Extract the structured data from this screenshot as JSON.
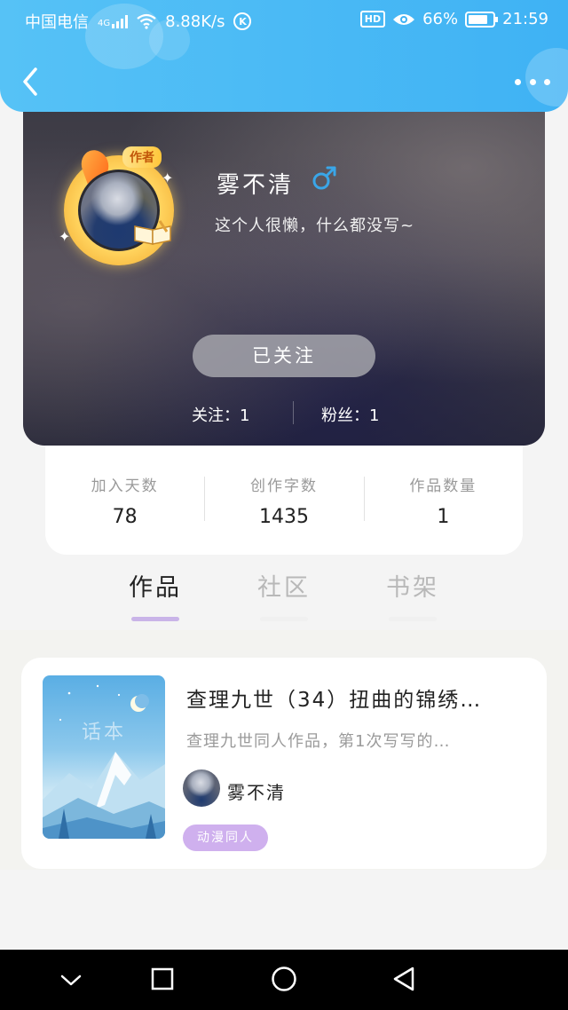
{
  "status_bar": {
    "carrier": "中国电信",
    "network": "4G",
    "speed": "8.88K/s",
    "k_badge": "K",
    "hd": "HD",
    "battery": "66%",
    "time": "21:59"
  },
  "header": {
    "back_icon": "chevron-left-icon",
    "more_icon": "more-dots-icon"
  },
  "profile": {
    "author_tag": "作者",
    "username": "雾不清",
    "gender_icon": "male-icon",
    "bio": "这个人很懒，什么都没写~",
    "follow_button": "已关注",
    "following_label": "关注：",
    "following_count": "1",
    "fans_label": "粉丝：",
    "fans_count": "1"
  },
  "stats": [
    {
      "label": "加入天数",
      "value": "78"
    },
    {
      "label": "创作字数",
      "value": "1435"
    },
    {
      "label": "作品数量",
      "value": "1"
    }
  ],
  "tabs": [
    {
      "label": "作品",
      "active": true
    },
    {
      "label": "社区",
      "active": false
    },
    {
      "label": "书架",
      "active": false
    }
  ],
  "works": [
    {
      "cover_watermark": "话本",
      "title": "查理九世（34）扭曲的锦绣…",
      "description": "查理九世同人作品，第1次写写的…",
      "author": "雾不清",
      "genre": "动漫同人"
    }
  ],
  "colors": {
    "header_blue": "#3fb2f4",
    "tab_indicator": "#c9b4e8",
    "genre_tag": "#cfb0ee"
  },
  "nav": {
    "hide_icon": "chevron-down-icon",
    "recent_icon": "square-icon",
    "home_icon": "circle-icon",
    "back_icon": "triangle-back-icon"
  }
}
